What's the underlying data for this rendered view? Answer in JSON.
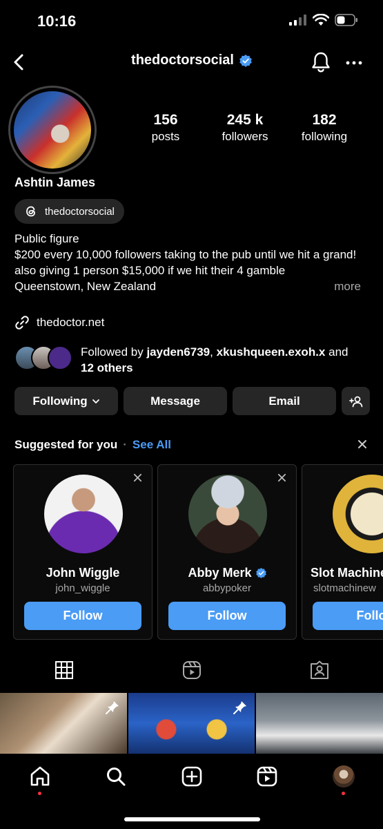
{
  "status_bar": {
    "time": "10:16"
  },
  "header": {
    "username": "thedoctorsocial",
    "verified": true
  },
  "profile": {
    "full_name": "Ashtin James",
    "threads_handle": "thedoctorsocial",
    "stats": [
      {
        "value": "156",
        "label": "posts"
      },
      {
        "value": "245 k",
        "label": "followers"
      },
      {
        "value": "182",
        "label": "following"
      }
    ],
    "bio": {
      "category": "Public figure",
      "line1": "$200 every 10,000 followers taking to the pub until we hit a grand!",
      "line2": "also giving 1 person $15,000 if we hit their 4 gamble",
      "more": "more",
      "line3": "Queenstown, New Zealand"
    },
    "link": "thedoctor.net",
    "followed_by": {
      "prefix": "Followed by",
      "user1": "jayden6739",
      "sep": ",",
      "user2": "xkushqueen.exoh.x",
      "and": "and",
      "others": "12 others"
    }
  },
  "actions": {
    "following": "Following",
    "message": "Message",
    "email": "Email"
  },
  "suggested": {
    "title": "Suggested for you",
    "see_all": "See All",
    "cards": [
      {
        "name": "John Wiggle",
        "username": "john_wiggle",
        "verified": false,
        "follow": "Follow"
      },
      {
        "name": "Abby Merk",
        "username": "abbypoker",
        "verified": true,
        "follow": "Follow"
      },
      {
        "name": "Slot Machine",
        "username": "slotmachinew",
        "verified": false,
        "follow": "Follow"
      }
    ]
  },
  "colors": {
    "accent": "#4a9cf5",
    "button_bg": "#262626",
    "notification": "#ff3040"
  }
}
